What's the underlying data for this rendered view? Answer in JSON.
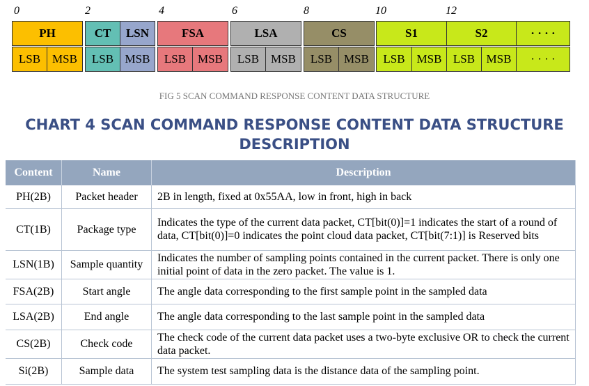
{
  "offsets": [
    "0",
    "2",
    "4",
    "6",
    "8",
    "10",
    "12"
  ],
  "fields": {
    "ph": "PH",
    "ct": "CT",
    "lsn": "LSN",
    "fsa": "FSA",
    "lsa": "LSA",
    "cs": "CS",
    "s1": "S1",
    "s2": "S2",
    "more": "· · · ·"
  },
  "lsb": "LSB",
  "msb": "MSB",
  "colors": {
    "ph": "#fcbf00",
    "ct": "#63bfb4",
    "lsn": "#97a6cc",
    "fsa": "#e7787c",
    "lsa": "#b0b0b0",
    "cs": "#968e67",
    "s": "#c8e81a",
    "title": "#3a4f85"
  },
  "caption": "FIG 5 SCAN COMMAND RESPONSE CONTENT DATA STRUCTURE",
  "title_line1": "CHART 4 SCAN COMMAND RESPONSE CONTENT DATA STRUCTURE",
  "title_line2": "DESCRIPTION",
  "table": {
    "headers": [
      "Content",
      "Name",
      "Description"
    ],
    "rows": [
      [
        "PH(2B)",
        "Packet header",
        "2B in length, fixed at 0x55AA, low in front, high in back"
      ],
      [
        "CT(1B)",
        "Package type",
        "Indicates the type of the current data packet, CT[bit(0)]=1 indicates the start of a round of data, CT[bit(0)]=0 indicates the point cloud data packet, CT[bit(7:1)] is Reserved bits"
      ],
      [
        "LSN(1B)",
        "Sample quantity",
        "Indicates the number of sampling points contained in the current packet. There is only one initial point of data in the zero packet. The value is 1."
      ],
      [
        "FSA(2B)",
        "Start angle",
        "The angle data corresponding to the first sample point in the sampled data"
      ],
      [
        "LSA(2B)",
        "End angle",
        "The angle data corresponding to the last sample point in the sampled data"
      ],
      [
        "CS(2B)",
        "Check code",
        "The check code of the current data packet uses a two-byte exclusive OR to check the current data packet."
      ],
      [
        "Si(2B)",
        "Sample data",
        "The system test sampling data is the distance data of the sampling point."
      ]
    ]
  }
}
